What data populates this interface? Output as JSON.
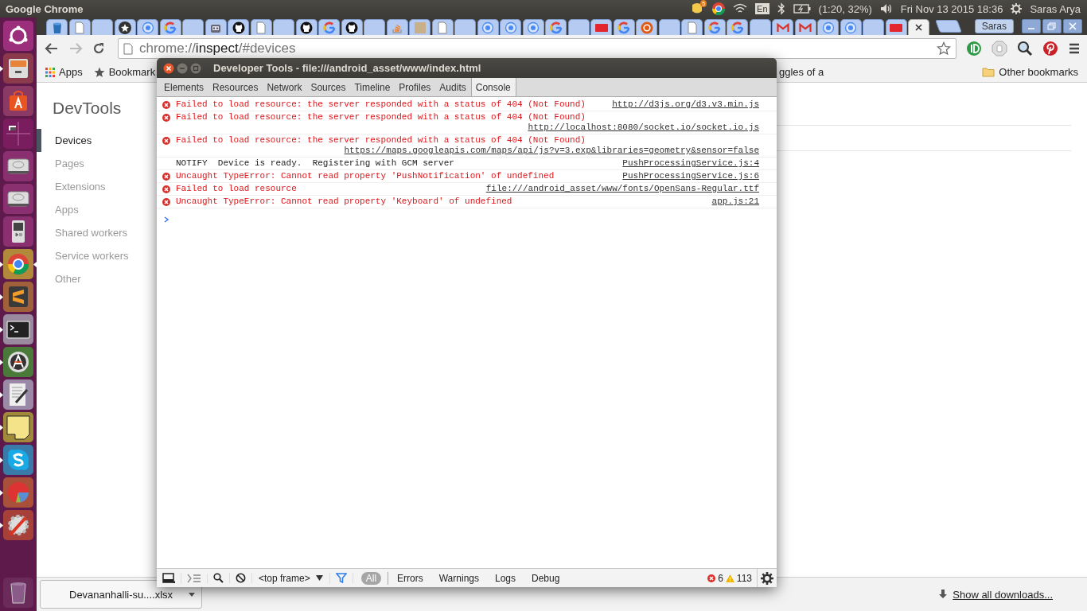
{
  "top_panel": {
    "app_title": "Google Chrome",
    "message_count": "5",
    "keyboard_layout": "En",
    "battery": "(1:20, 32%)",
    "clock": "Fri Nov 13 2015 18:36",
    "user": "Saras Arya"
  },
  "launcher": [
    {
      "kind": "dash",
      "running": false,
      "focused": false
    },
    {
      "kind": "files",
      "running": true,
      "focused": false
    },
    {
      "kind": "software",
      "running": false,
      "focused": false
    },
    {
      "kind": "workspaces",
      "running": false,
      "focused": false
    },
    {
      "kind": "drive",
      "running": false,
      "focused": false
    },
    {
      "kind": "drive",
      "running": false,
      "focused": false
    },
    {
      "kind": "music",
      "running": false,
      "focused": false
    },
    {
      "kind": "browser",
      "running": true,
      "focused": true
    },
    {
      "kind": "sublime",
      "running": true,
      "focused": false
    },
    {
      "kind": "terminal",
      "running": true,
      "focused": false
    },
    {
      "kind": "updater",
      "running": true,
      "focused": false
    },
    {
      "kind": "text-editor",
      "running": true,
      "focused": false
    },
    {
      "kind": "notes",
      "running": true,
      "focused": false
    },
    {
      "kind": "skype",
      "running": true,
      "focused": false
    },
    {
      "kind": "disk-usage",
      "running": true,
      "focused": false
    },
    {
      "kind": "settings",
      "running": true,
      "focused": false
    },
    {
      "kind": "trash",
      "running": false,
      "focused": false
    }
  ],
  "browser": {
    "tabs": [
      {
        "kind": "bin",
        "selected": false
      },
      {
        "kind": "page",
        "selected": false
      },
      {
        "kind": "blank",
        "selected": false
      },
      {
        "kind": "star",
        "selected": false
      },
      {
        "kind": "ring",
        "selected": false
      },
      {
        "kind": "google",
        "selected": false
      },
      {
        "kind": "blank",
        "selected": false
      },
      {
        "kind": "robot",
        "selected": false
      },
      {
        "kind": "github",
        "selected": false
      },
      {
        "kind": "page",
        "selected": false
      },
      {
        "kind": "blank",
        "selected": false
      },
      {
        "kind": "github",
        "selected": false
      },
      {
        "kind": "google",
        "selected": false
      },
      {
        "kind": "github",
        "selected": false
      },
      {
        "kind": "blank",
        "selected": false
      },
      {
        "kind": "stack",
        "selected": false
      },
      {
        "kind": "photo",
        "selected": false
      },
      {
        "kind": "page",
        "selected": false
      },
      {
        "kind": "blank",
        "selected": false
      },
      {
        "kind": "ring",
        "selected": false
      },
      {
        "kind": "ring",
        "selected": false
      },
      {
        "kind": "ring",
        "selected": false
      },
      {
        "kind": "google",
        "selected": false
      },
      {
        "kind": "blank",
        "selected": false
      },
      {
        "kind": "act",
        "selected": false
      },
      {
        "kind": "google",
        "selected": false
      },
      {
        "kind": "orange",
        "selected": false
      },
      {
        "kind": "blank",
        "selected": false
      },
      {
        "kind": "page",
        "selected": false
      },
      {
        "kind": "google",
        "selected": false
      },
      {
        "kind": "google",
        "selected": false
      },
      {
        "kind": "blank",
        "selected": false
      },
      {
        "kind": "gmail",
        "selected": false
      },
      {
        "kind": "gmail",
        "selected": false
      },
      {
        "kind": "ring",
        "selected": false
      },
      {
        "kind": "ring",
        "selected": false
      },
      {
        "kind": "blank",
        "selected": false
      },
      {
        "kind": "act",
        "selected": false
      },
      {
        "kind": "blank",
        "selected": true
      }
    ],
    "profile": "Saras",
    "address": {
      "scheme": "chrome://",
      "host": "inspect",
      "path": "/#devices"
    },
    "bookmarks": [
      {
        "label": "Apps",
        "kind": "apps"
      },
      {
        "label": "Bookmark",
        "kind": "star"
      }
    ],
    "partial_bookmark": "ggles of a",
    "other_bookmarks": "Other bookmarks"
  },
  "page": {
    "title": "DevTools",
    "nav": [
      {
        "label": "Devices",
        "selected": true
      },
      {
        "label": "Pages",
        "selected": false
      },
      {
        "label": "Extensions",
        "selected": false
      },
      {
        "label": "Apps",
        "selected": false
      },
      {
        "label": "Shared workers",
        "selected": false
      },
      {
        "label": "Service workers",
        "selected": false
      },
      {
        "label": "Other",
        "selected": false
      }
    ]
  },
  "downloads": {
    "file": "Devananhalli-su....xlsx",
    "show_all": "Show all downloads..."
  },
  "devtools": {
    "title": "Developer Tools - file:///android_asset/www/index.html",
    "tabs": [
      {
        "label": "Elements",
        "selected": false
      },
      {
        "label": "Resources",
        "selected": false
      },
      {
        "label": "Network",
        "selected": false
      },
      {
        "label": "Sources",
        "selected": false
      },
      {
        "label": "Timeline",
        "selected": false
      },
      {
        "label": "Profiles",
        "selected": false
      },
      {
        "label": "Audits",
        "selected": false
      },
      {
        "label": "Console",
        "selected": true
      }
    ],
    "messages": [
      {
        "kind": "error",
        "message": "Failed to load resource: the server responded with a status of 404 (Not Found)",
        "source": "http://d3js.org/d3.v3.min.js"
      },
      {
        "kind": "error",
        "message": "Failed to load resource: the server responded with a status of 404 (Not Found)",
        "source": "http://localhost:8080/socket.io/socket.io.js"
      },
      {
        "kind": "error",
        "message": "Failed to load resource: the server responded with a status of 404 (Not Found)",
        "source": "https://maps.googleapis.com/maps/api/js?v=3.exp&libraries=geometry&sensor=false"
      },
      {
        "kind": "log",
        "message": "NOTIFY  Device is ready.  Registering with GCM server",
        "source": "PushProcessingService.js:4"
      },
      {
        "kind": "error",
        "message": "Uncaught TypeError: Cannot read property 'PushNotification' of undefined",
        "source": "PushProcessingService.js:6"
      },
      {
        "kind": "error",
        "message": "Failed to load resource",
        "source": "file:///android_asset/www/fonts/OpenSans-Regular.ttf"
      },
      {
        "kind": "error",
        "message": "Uncaught TypeError: Cannot read property 'Keyboard' of undefined",
        "source": "app.js:21"
      }
    ],
    "context": "<top frame>",
    "filters": [
      {
        "label": "All",
        "selected": true
      },
      {
        "label": "Errors",
        "selected": false
      },
      {
        "label": "Warnings",
        "selected": false
      },
      {
        "label": "Logs",
        "selected": false
      },
      {
        "label": "Debug",
        "selected": false
      }
    ],
    "error_count": "6",
    "warning_count": "113"
  }
}
